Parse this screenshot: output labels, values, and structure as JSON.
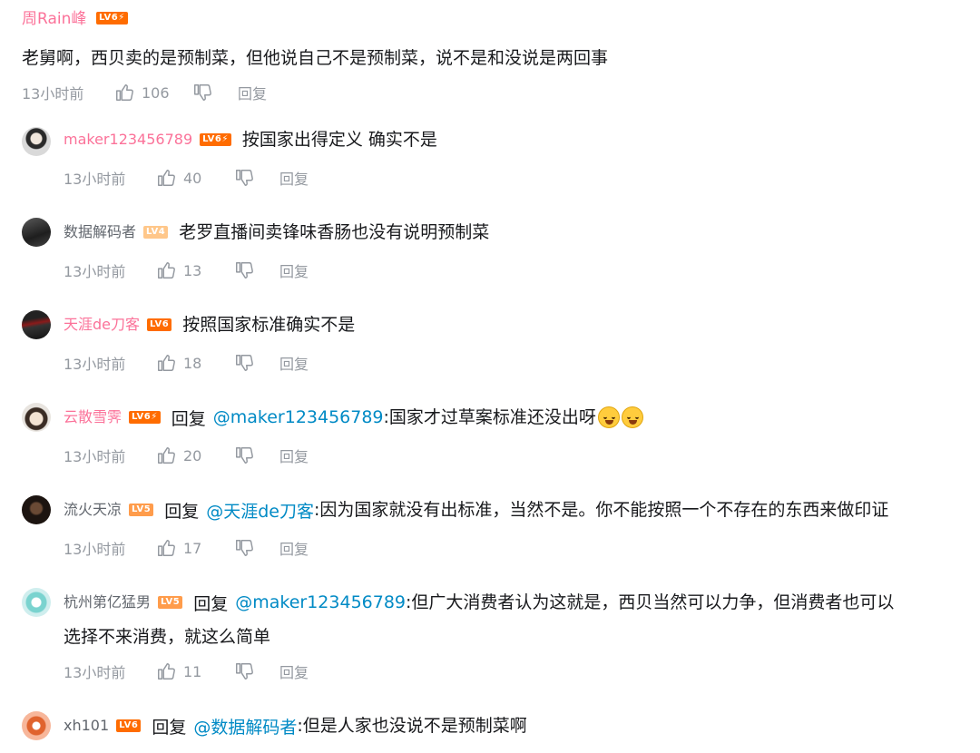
{
  "main": {
    "user": "周Rain峰",
    "level": "LV6⚡",
    "text": "老舅啊，西贝卖的是预制菜，但他说自己不是预制菜，说不是和没说是两回事",
    "time": "13小时前",
    "likes": "106",
    "reply_label": "回复"
  },
  "replies": [
    {
      "user": "maker123456789",
      "level": "LV6⚡",
      "prefix": "",
      "at": "",
      "text": "按国家出得定义 确实不是",
      "text2": "",
      "time": "13小时前",
      "likes": "40",
      "reply_label": "回复"
    },
    {
      "user": "数据解码者",
      "level": "LV4",
      "prefix": "",
      "at": "",
      "text": "老罗直播间卖锋味香肠也没有说明预制菜",
      "text2": "",
      "time": "13小时前",
      "likes": "13",
      "reply_label": "回复"
    },
    {
      "user": "天涯de刀客",
      "level": "LV6",
      "prefix": "",
      "at": "",
      "text": "按照国家标准确实不是",
      "text2": "",
      "time": "13小时前",
      "likes": "18",
      "reply_label": "回复"
    },
    {
      "user": "云散雪霁",
      "level": "LV6⚡",
      "prefix": "回复",
      "at": "@maker123456789",
      "text": ":国家才过草案标准还没出呀",
      "text2": "",
      "time": "13小时前",
      "likes": "20",
      "reply_label": "回复"
    },
    {
      "user": "流火天凉",
      "level": "LV5",
      "prefix": "回复",
      "at": "@天涯de刀客",
      "text": ":因为国家就没有出标准，当然不是。你不能按照一个不存在的东西来做印证",
      "text2": "",
      "time": "13小时前",
      "likes": "17",
      "reply_label": "回复"
    },
    {
      "user": "杭州第亿猛男",
      "level": "LV5",
      "prefix": "回复",
      "at": "@maker123456789",
      "text": ":但广大消费者认为这就是，西贝当然可以力争，但消费者也可以",
      "text2": "选择不来消费，就这么简单",
      "time": "13小时前",
      "likes": "11",
      "reply_label": "回复"
    },
    {
      "user": "xh101",
      "level": "LV6",
      "prefix": "回复",
      "at": "@数据解码者",
      "text": ":但是人家也没说不是预制菜啊",
      "text2": "",
      "time": "",
      "likes": "",
      "reply_label": ""
    }
  ],
  "colors": {
    "pink_name": "#fb7299",
    "link_blue": "#008ac5",
    "meta_gray": "#9499a0",
    "lv6": "#ff6c00",
    "lv5": "#ff9c4b",
    "lv4": "#ffc78a"
  },
  "icons": [
    "thumb-up-icon",
    "thumb-down-icon",
    "laughing-tears-emoji"
  ]
}
